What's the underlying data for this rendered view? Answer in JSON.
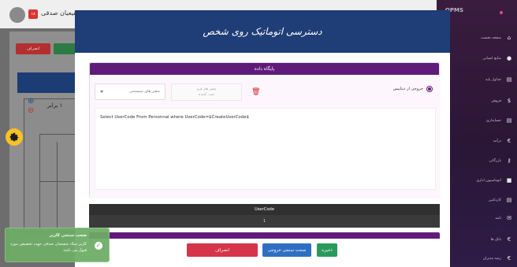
{
  "background": {
    "header_title": "سامانه شفیعیان صدقی",
    "badge": "۱۸",
    "cancel_label": "انصراف",
    "zoom_label": "۱ برابر"
  },
  "sidebar": {
    "logo": "OPMS",
    "items": [
      {
        "label": "صفحه نخست",
        "icon": "home-icon"
      },
      {
        "label": "منابع انسانی",
        "icon": "user-icon"
      },
      {
        "label": "جداول پایه",
        "icon": "document-icon"
      },
      {
        "label": "فروش",
        "icon": "dollar-icon"
      },
      {
        "label": "حسابداری",
        "icon": "document-icon"
      },
      {
        "label": "درآمد",
        "icon": "euro-icon"
      },
      {
        "label": "بازرگانی",
        "icon": "key-icon"
      },
      {
        "label": "اتوماسیون اداری",
        "icon": "lock-icon"
      },
      {
        "label": "کاردکس",
        "icon": "document-icon"
      },
      {
        "label": "نامه",
        "icon": "mail-icon"
      },
      {
        "label": "بانک ها",
        "icon": "euro-icon"
      },
      {
        "label": "رشد مدیران",
        "icon": "euro-icon"
      }
    ]
  },
  "modal": {
    "title": "دسترسی اتوماتیک روی شخص",
    "db_card": {
      "title": "پایگاه داده",
      "radio_label": "خروجی از دیتابیس",
      "select_value": "متغیر های سیستمی",
      "field_label": "متغیر های فرم",
      "field_placeholder": "ثبت کننده",
      "sql": "Select UserCode From Personnal where UserCode=$CreateUserCode$"
    },
    "table": {
      "header": "UserCode",
      "rows": [
        "1"
      ]
    },
    "footer": {
      "cancel": "انصراف",
      "check": "صحت سنجی خروجی",
      "save": "ذخیره"
    }
  },
  "toast": {
    "title": "صحت سنجی کاربر",
    "message": "کاربر میلاد شفیعیان صدقی جهت تخصیص مورد قبول می باشد"
  },
  "colors": {
    "modal_header": "#1f3d76",
    "card_header": "#5f1b7a",
    "cancel": "#d5344a",
    "check": "#2f6fc2",
    "save": "#2a9a5b",
    "toast": "#6dac66"
  }
}
